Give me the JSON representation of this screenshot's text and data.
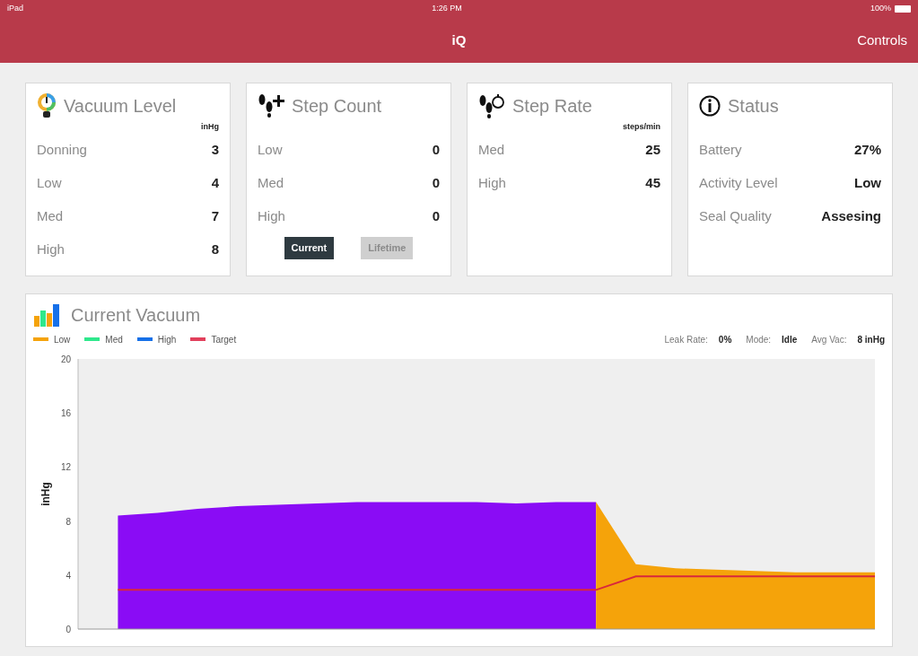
{
  "status_bar": {
    "device": "iPad",
    "time": "1:26 PM",
    "battery": "100%"
  },
  "nav": {
    "title": "iQ",
    "action": "Controls"
  },
  "cards": [
    {
      "kind": "vacuum",
      "title": "Vacuum Level",
      "unit": "inHg",
      "rows": [
        {
          "label": "Donning",
          "value": "3"
        },
        {
          "label": "Low",
          "value": "4"
        },
        {
          "label": "Med",
          "value": "7"
        },
        {
          "label": "High",
          "value": "8"
        }
      ]
    },
    {
      "kind": "steps",
      "title": "Step Count",
      "rows": [
        {
          "label": "Low",
          "value": "0"
        },
        {
          "label": "Med",
          "value": "0"
        },
        {
          "label": "High",
          "value": "0"
        }
      ],
      "buttons": [
        {
          "label": "Current",
          "selected": true
        },
        {
          "label": "Lifetime",
          "selected": false
        }
      ]
    },
    {
      "kind": "rate",
      "title": "Step Rate",
      "unit": "steps/min",
      "rows": [
        {
          "label": "Med",
          "value": "25"
        },
        {
          "label": "High",
          "value": "45"
        }
      ]
    },
    {
      "kind": "status",
      "title": "Status",
      "rows": [
        {
          "label": "Battery",
          "value": "27%"
        },
        {
          "label": "Activity Level",
          "value": "Low"
        },
        {
          "label": "Seal Quality",
          "value": "Assesing"
        }
      ]
    }
  ],
  "chart_panel": {
    "title": "Current Vacuum",
    "legend": [
      {
        "label": "Low",
        "color": "#f5a30a"
      },
      {
        "label": "Med",
        "color": "#2fe88c"
      },
      {
        "label": "High",
        "color": "#1670e8"
      },
      {
        "label": "Target",
        "color": "#e2405c"
      }
    ],
    "stats": [
      {
        "label": "Leak Rate:",
        "value": "0%"
      },
      {
        "label": "Mode:",
        "value": "Idle"
      },
      {
        "label": "Avg Vac:",
        "value": "8 inHg"
      }
    ],
    "chart_data": {
      "type": "area",
      "ylabel": "inHg",
      "categories": [
        null,
        null,
        null,
        null,
        null,
        null,
        null,
        null,
        null,
        null,
        null,
        null,
        null,
        null,
        null,
        null,
        null,
        null,
        null,
        null,
        null
      ],
      "ylim": [
        0,
        20
      ],
      "yticks": [
        0,
        4,
        8,
        12,
        16,
        20
      ],
      "series": [
        {
          "color": "#8a0cf5",
          "values": [
            null,
            8.4,
            8.6,
            8.9,
            9.1,
            9.2,
            9.3,
            9.4,
            9.4,
            9.4,
            9.4,
            9.3,
            9.4,
            9.4,
            null,
            null,
            null,
            null,
            null,
            null,
            null
          ]
        },
        {
          "color": "#f5a30a",
          "values": [
            null,
            null,
            null,
            null,
            null,
            null,
            null,
            null,
            null,
            null,
            null,
            null,
            null,
            9.4,
            4.8,
            4.5,
            4.4,
            4.3,
            4.2,
            4.2,
            4.2
          ]
        },
        {
          "color": "#d8283c",
          "type": "line",
          "values": [
            null,
            2.9,
            2.9,
            2.9,
            2.9,
            2.9,
            2.9,
            2.9,
            2.9,
            2.9,
            2.9,
            2.9,
            2.9,
            2.9,
            3.9,
            3.9,
            3.9,
            3.9,
            3.9,
            3.9,
            3.9
          ]
        }
      ]
    }
  }
}
